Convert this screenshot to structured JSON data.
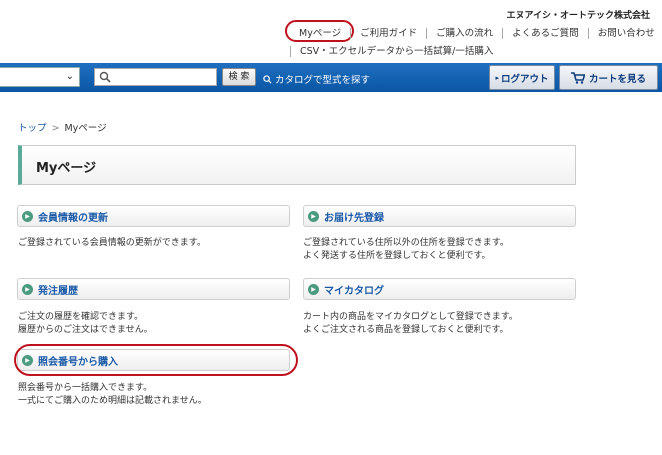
{
  "company": "エヌアイシ・オートテック株式会社",
  "topnav": {
    "row1": [
      "Myページ",
      "ご利用ガイド",
      "ご購入の流れ",
      "よくあるご質問",
      "お問い合わせ"
    ],
    "row2": [
      "CSV・エクセルデータから一括試算/一括購入"
    ]
  },
  "searchbar": {
    "search_button": "検 索",
    "catalog_link": "カタログで型式を探す",
    "logout": "ログアウト",
    "cart": "カートを見る"
  },
  "breadcrumb": {
    "home": "トップ",
    "separator": ">",
    "current": "Myページ"
  },
  "page_title": "Myページ",
  "cards": [
    {
      "title": "会員情報の更新",
      "desc": [
        "ご登録されている会員情報の更新ができます。"
      ]
    },
    {
      "title": "お届け先登録",
      "desc": [
        "ご登録されている住所以外の住所を登録できます。",
        "よく発送する住所を登録しておくと便利です。"
      ]
    },
    {
      "title": "発注履歴",
      "desc": [
        "ご注文の履歴を確認できます。",
        "履歴からのご注文はできません。"
      ]
    },
    {
      "title": "マイカタログ",
      "desc": [
        "カート内の商品をマイカタログとして登録できます。",
        "よくご注文される商品を登録しておくと便利です。"
      ]
    },
    {
      "title": "照会番号から購入",
      "desc": [
        "照会番号から一括購入できます。",
        "一式にてご購入のため明細は記載されません。"
      ]
    }
  ],
  "colors": {
    "nav_blue": "#0b56a5",
    "link_blue": "#1a5aa8",
    "highlight_red": "#c0111f",
    "icon_green": "#4a9b7f"
  }
}
